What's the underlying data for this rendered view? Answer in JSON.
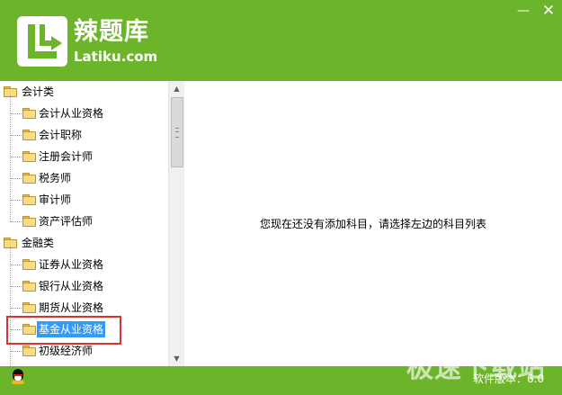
{
  "app": {
    "logo_title": "辣题库",
    "logo_url": "Latiku.com",
    "minimize_symbol": "—",
    "close_symbol": "✕"
  },
  "tree": {
    "groups": [
      {
        "label": "会计类",
        "children": [
          "会计从业资格",
          "会计职称",
          "注册会计师",
          "税务师",
          "审计师",
          "资产评估师"
        ]
      },
      {
        "label": "金融类",
        "children": [
          "证券从业资格",
          "银行从业资格",
          "期货从业资格",
          "基金从业资格",
          "初级经济师"
        ]
      }
    ],
    "selected": "基金从业资格"
  },
  "main": {
    "empty_message": "您现在还没有添加科目，请选择左边的科目列表"
  },
  "footer": {
    "version": "软件版本：6.0",
    "watermark": "极速下载站",
    "qq_icon": "qq-penguin-icon"
  },
  "colors": {
    "brand_green": "#6cb52a",
    "selection_blue": "#3399ff",
    "highlight_red": "#d9342b"
  }
}
